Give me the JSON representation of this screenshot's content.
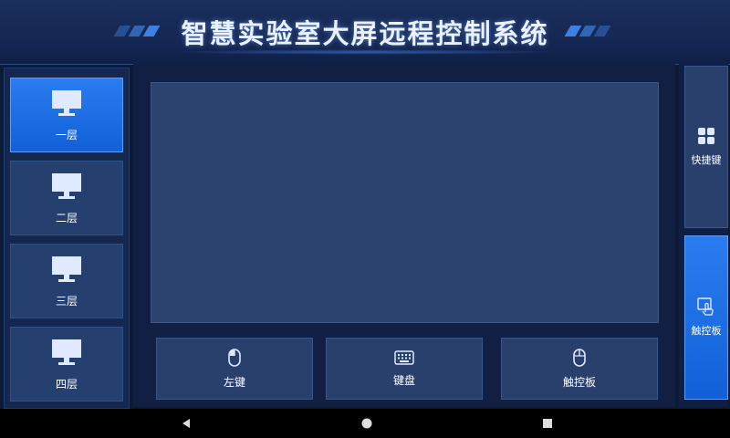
{
  "header": {
    "title": "智慧实验室大屏远程控制系统"
  },
  "floors": [
    {
      "label": "一层",
      "icon": "monitor-icon",
      "active": true
    },
    {
      "label": "二层",
      "icon": "monitor-icon",
      "active": false
    },
    {
      "label": "三层",
      "icon": "monitor-icon",
      "active": false
    },
    {
      "label": "四层",
      "icon": "monitor-icon",
      "active": false
    }
  ],
  "controls": {
    "left_click": {
      "label": "左键",
      "icon": "mouse-icon"
    },
    "keyboard": {
      "label": "键盘",
      "icon": "keyboard-icon"
    },
    "touchpad": {
      "label": "触控板",
      "icon": "mouse-icon"
    }
  },
  "side": {
    "shortcuts": {
      "label": "快捷键",
      "icon": "grid-icon",
      "active": false
    },
    "touchpad": {
      "label": "触控板",
      "icon": "touch-icon",
      "active": true
    }
  },
  "nav": {
    "back": "back-icon",
    "home": "home-icon",
    "recent": "recents-icon"
  },
  "colors": {
    "accent": "#1a6ef0",
    "panel": "#25406e",
    "background": "#0c1a36"
  }
}
